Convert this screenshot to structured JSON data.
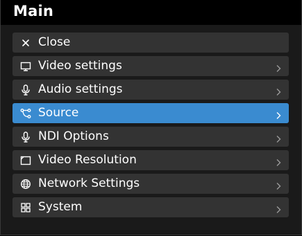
{
  "header": {
    "title": "Main"
  },
  "colors": {
    "item_bg": "#333333",
    "active_bg": "#3a8bd0",
    "title_bar": "#000000",
    "panel_bg": "#1a1a1a",
    "chevron": "#9a9a9a"
  },
  "menu": {
    "items": [
      {
        "label": "Close",
        "icon": "close-icon",
        "has_submenu": false,
        "active": false
      },
      {
        "label": "Video settings",
        "icon": "monitor-icon",
        "has_submenu": true,
        "active": false
      },
      {
        "label": "Audio settings",
        "icon": "microphone-icon",
        "has_submenu": true,
        "active": false
      },
      {
        "label": "Source",
        "icon": "source-branch-icon",
        "has_submenu": true,
        "active": true
      },
      {
        "label": "NDI Options",
        "icon": "microphone-icon",
        "has_submenu": true,
        "active": false
      },
      {
        "label": "Video Resolution",
        "icon": "resolution-icon",
        "has_submenu": true,
        "active": false
      },
      {
        "label": "Network Settings",
        "icon": "globe-icon",
        "has_submenu": true,
        "active": false
      },
      {
        "label": "System",
        "icon": "grid-icon",
        "has_submenu": true,
        "active": false
      }
    ]
  }
}
